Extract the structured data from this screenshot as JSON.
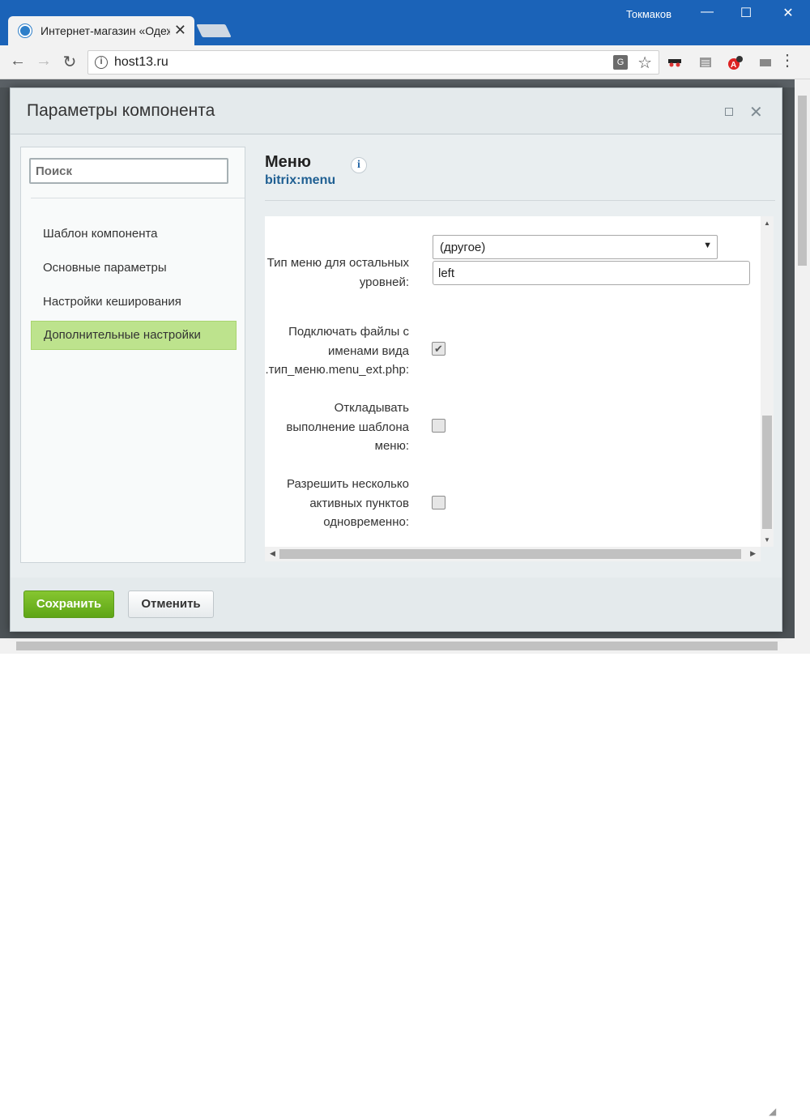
{
  "browser": {
    "tab_title": "Интернет-магазин «Одежда»",
    "tab_close": "✕",
    "user": "Токмаков",
    "window_controls": {
      "minimize": "—",
      "maximize": "☐",
      "close": "✕"
    },
    "url": "host13.ru",
    "nav": {
      "back": "←",
      "forward": "→",
      "reload": "↻"
    },
    "icons": [
      "info-icon",
      "translate-icon",
      "star-icon",
      "incognito-extension-icon",
      "list-extension-icon",
      "antivirus-extension-icon",
      "cast-extension-icon",
      "menu-icon"
    ],
    "antivirus_badge": "A",
    "info_glyph": "i",
    "translate_glyph": "G",
    "star_glyph": "☆",
    "menu_glyph": "⋮"
  },
  "dialog": {
    "title": "Параметры компонента",
    "close_glyph": "✕",
    "search_placeholder": "Поиск",
    "sidebar": {
      "items": [
        {
          "label": "Шаблон компонента",
          "active": false
        },
        {
          "label": "Основные параметры",
          "active": false
        },
        {
          "label": "Настройки кеширования",
          "active": false
        },
        {
          "label": "Дополнительные настройки",
          "active": true
        }
      ]
    },
    "component": {
      "name": "Меню",
      "code": "bitrix:menu",
      "info_glyph": "i"
    },
    "fields": [
      {
        "label_lines": [
          "Тип меню для остальных",
          "уровней:"
        ],
        "select_value": "(другое)",
        "select_arrow": "▼",
        "input_value": "left"
      },
      {
        "label_lines": [
          "Подключать файлы с",
          "именами вида",
          ".тип_меню.menu_ext.php:"
        ],
        "checked": true,
        "check_glyph": "✔"
      },
      {
        "label_lines": [
          "Откладывать",
          "выполнение шаблона",
          "меню:"
        ],
        "checked": false
      },
      {
        "label_lines": [
          "Разрешить несколько",
          "активных пунктов",
          "одновременно:"
        ],
        "checked": false
      }
    ],
    "scroll_glyphs": {
      "up": "▲",
      "down": "▼",
      "left": "◀",
      "right": "▶"
    },
    "buttons": {
      "save": "Сохранить",
      "cancel": "Отменить"
    }
  }
}
